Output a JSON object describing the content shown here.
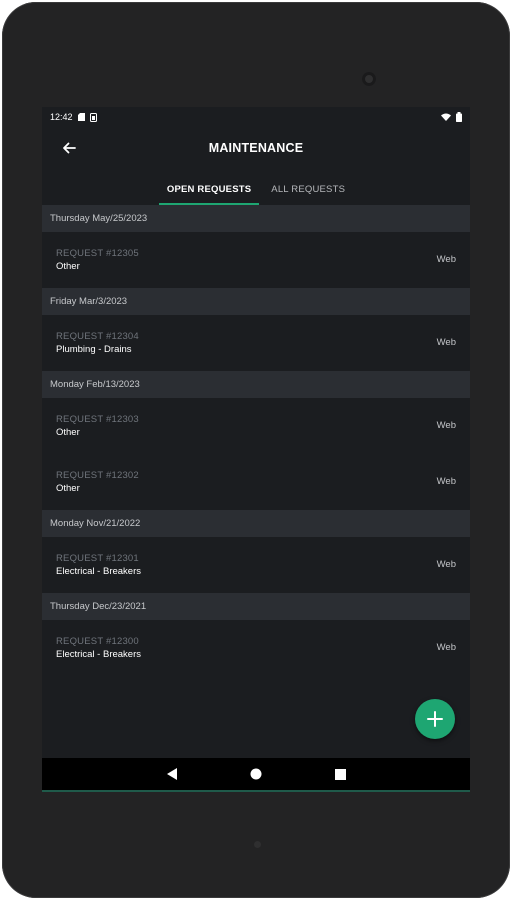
{
  "status_bar": {
    "time": "12:42",
    "icons_left": [
      "sd-card-icon",
      "sim-icon"
    ],
    "icons_right": [
      "wifi-icon",
      "battery-icon"
    ]
  },
  "app_bar": {
    "title": "MAINTENANCE",
    "back_icon": "arrow-left-icon"
  },
  "tabs": [
    {
      "label": "OPEN REQUESTS",
      "active": true
    },
    {
      "label": "ALL REQUESTS",
      "active": false
    }
  ],
  "groups": [
    {
      "date": "Thursday May/25/2023",
      "requests": [
        {
          "number": "REQUEST #12305",
          "category": "Other",
          "source": "Web"
        }
      ]
    },
    {
      "date": "Friday Mar/3/2023",
      "requests": [
        {
          "number": "REQUEST #12304",
          "category": "Plumbing - Drains",
          "source": "Web"
        }
      ]
    },
    {
      "date": "Monday Feb/13/2023",
      "requests": [
        {
          "number": "REQUEST #12303",
          "category": "Other",
          "source": "Web"
        },
        {
          "number": "REQUEST #12302",
          "category": "Other",
          "source": "Web"
        }
      ]
    },
    {
      "date": "Monday Nov/21/2022",
      "requests": [
        {
          "number": "REQUEST #12301",
          "category": "Electrical - Breakers",
          "source": "Web"
        }
      ]
    },
    {
      "date": "Thursday Dec/23/2021",
      "requests": [
        {
          "number": "REQUEST #12300",
          "category": "Electrical - Breakers",
          "source": "Web"
        }
      ]
    }
  ],
  "fab": {
    "icon": "plus-icon"
  },
  "nav_bar": {
    "icons": [
      "back-triangle-icon",
      "home-circle-icon",
      "recents-square-icon"
    ]
  },
  "colors": {
    "accent": "#1ea672",
    "background": "#1b1d20",
    "header_bg": "#2b2e33"
  }
}
